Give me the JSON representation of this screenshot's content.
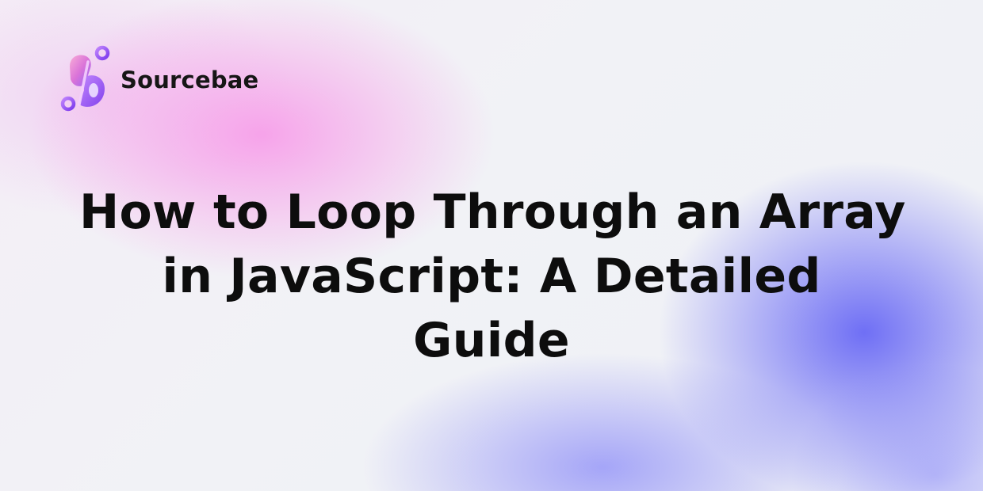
{
  "brand": {
    "name": "Sourcebae",
    "colors": {
      "logo_pink": "#f472b6",
      "logo_purple": "#a855f7",
      "logo_violet": "#7c3aed"
    }
  },
  "headline": {
    "lines": [
      "How to Loop Through an Array",
      "in JavaScript: A Detailed",
      "Guide"
    ]
  },
  "background": {
    "colors": {
      "pink_glow": "#f796e8",
      "blue_glow": "#6868f5",
      "base": "#f1f1f6"
    }
  }
}
